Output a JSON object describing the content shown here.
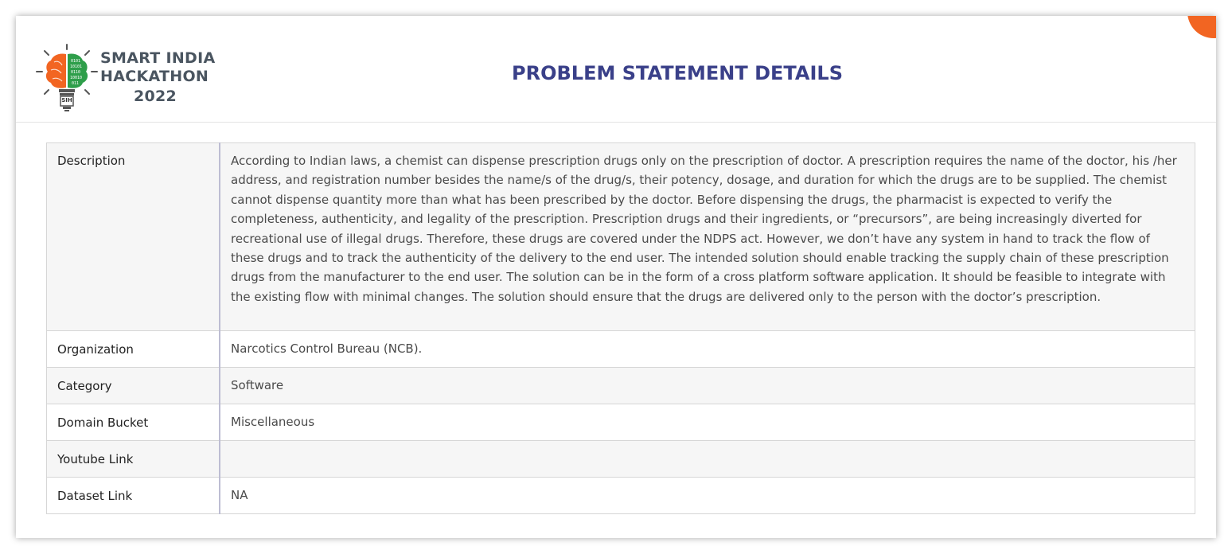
{
  "header": {
    "logo": {
      "line1": "SMART INDIA",
      "line2": "HACKATHON",
      "year": "2022",
      "badge": "SIH",
      "colors": {
        "orange": "#f26522",
        "green": "#2e9e4a",
        "text": "#4a5560"
      }
    },
    "title": "PROBLEM STATEMENT DETAILS",
    "title_color": "#3a4089",
    "accent_color": "#f26522"
  },
  "details": {
    "rows": [
      {
        "label": "Description",
        "value": "According to Indian laws, a chemist can dispense prescription drugs only on the prescription of doctor. A prescription requires the name of the doctor, his /her address, and registration number besides the name/s of the drug/s, their potency, dosage, and duration for which the drugs are to be supplied. The chemist cannot dispense quantity more than what has been prescribed by the doctor. Before dispensing the drugs, the pharmacist is expected to verify the completeness, authenticity, and legality of the prescription. Prescription drugs and their ingredients, or “precursors”, are being increasingly diverted for recreational use of illegal drugs. Therefore, these drugs are covered under the NDPS act. However, we don’t have any system in hand to track the flow of these drugs and to track the authenticity of the delivery to the end user. The intended solution should enable tracking the supply chain of these prescription drugs from the manufacturer to the end user. The solution can be in the form of a cross platform software application. It should be feasible to integrate with the existing flow with minimal changes. The solution should ensure that the drugs are delivered only to the person with the doctor’s prescription."
      },
      {
        "label": "Organization",
        "value": "Narcotics Control Bureau (NCB)."
      },
      {
        "label": "Category",
        "value": "Software"
      },
      {
        "label": "Domain Bucket",
        "value": "Miscellaneous"
      },
      {
        "label": "Youtube Link",
        "value": ""
      },
      {
        "label": "Dataset Link",
        "value": "NA"
      }
    ]
  }
}
